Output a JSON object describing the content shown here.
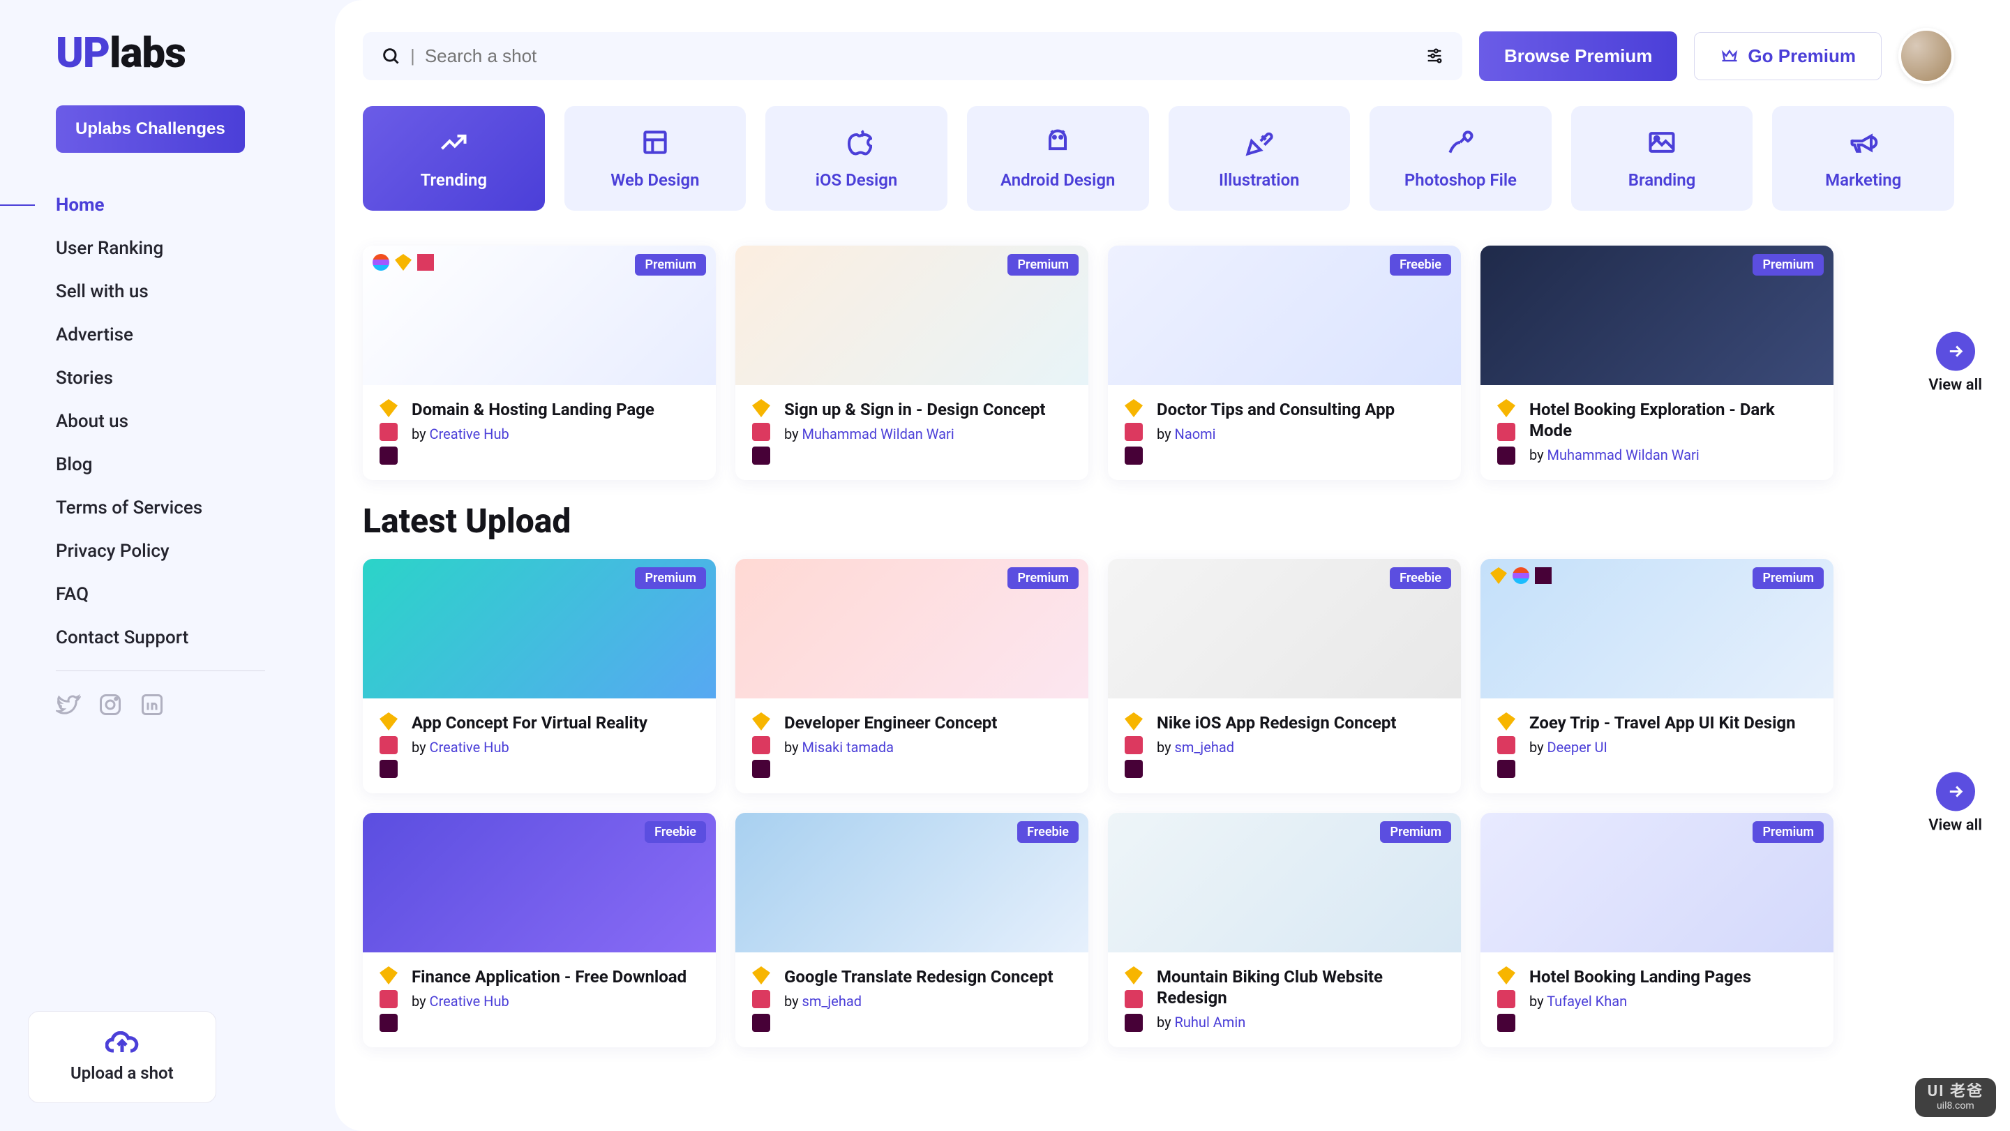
{
  "logo": {
    "part1": "UP",
    "part2": "labs"
  },
  "challenges_label": "Uplabs Challenges",
  "nav": [
    "Home",
    "User Ranking",
    "Sell with us",
    "Advertise",
    "Stories",
    "About us",
    "Blog",
    "Terms of Services",
    "Privacy Policy",
    "FAQ",
    "Contact Support"
  ],
  "upload_label": "Upload a shot",
  "search": {
    "placeholder": "Search a shot"
  },
  "buttons": {
    "browse_premium": "Browse Premium",
    "go_premium": "Go Premium"
  },
  "categories": [
    "Trending",
    "Web Design",
    "iOS Design",
    "Android Design",
    "Illustration",
    "Photoshop File",
    "Branding",
    "Marketing"
  ],
  "view_all": "View all",
  "latest_heading": "Latest Upload",
  "by_prefix": "by ",
  "trending_cards": [
    {
      "title": "Domain & Hosting Landing Page",
      "author": "Creative Hub",
      "badge": "Premium",
      "thumb": "t1",
      "topicons": [
        "figma",
        "sketch",
        "invision"
      ]
    },
    {
      "title": "Sign up & Sign in - Design Concept",
      "author": "Muhammad Wildan Wari",
      "badge": "Premium",
      "thumb": "t2",
      "topicons": []
    },
    {
      "title": "Doctor Tips and Consulting App",
      "author": "Naomi",
      "badge": "Freebie",
      "thumb": "t3",
      "topicons": []
    },
    {
      "title": "Hotel Booking Exploration - Dark Mode",
      "author": "Muhammad Wildan Wari",
      "badge": "Premium",
      "thumb": "t4",
      "topicons": []
    }
  ],
  "latest_cards": [
    {
      "title": "App Concept For Virtual Reality",
      "author": "Creative Hub",
      "badge": "Premium",
      "thumb": "t5",
      "topicons": []
    },
    {
      "title": "Developer Engineer Concept",
      "author": "Misaki tamada",
      "badge": "Premium",
      "thumb": "t6",
      "topicons": []
    },
    {
      "title": "Nike iOS App Redesign Concept",
      "author": "sm_jehad",
      "badge": "Freebie",
      "thumb": "t7",
      "topicons": []
    },
    {
      "title": "Zoey Trip - Travel App UI Kit Design",
      "author": "Deeper UI",
      "badge": "Premium",
      "thumb": "t8",
      "topicons": [
        "sketch",
        "figma",
        "xd"
      ]
    },
    {
      "title": "Finance Application - Free Download",
      "author": "Creative Hub",
      "badge": "Freebie",
      "thumb": "t9",
      "topicons": []
    },
    {
      "title": "Google Translate Redesign Concept",
      "author": "sm_jehad",
      "badge": "Freebie",
      "thumb": "t10",
      "topicons": []
    },
    {
      "title": "Mountain Biking Club Website Redesign",
      "author": "Ruhul Amin",
      "badge": "Premium",
      "thumb": "t11",
      "topicons": []
    },
    {
      "title": "Hotel Booking Landing Pages",
      "author": "Tufayel Khan",
      "badge": "Premium",
      "thumb": "t12",
      "topicons": []
    }
  ],
  "watermark": {
    "brand": "UI 老爸",
    "sub": "uil8.com"
  }
}
